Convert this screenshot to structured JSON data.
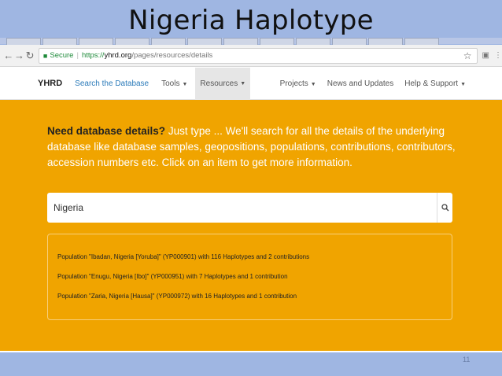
{
  "slide": {
    "title": "Nigeria Haplotype",
    "page_number": "11"
  },
  "browser": {
    "secure_label": "Secure",
    "url_proto": "https://",
    "url_host": "yhrd.org",
    "url_path": "/pages/resources/details"
  },
  "site_nav": {
    "logo": "YHRD",
    "items": [
      {
        "label": "Search the Database"
      },
      {
        "label": "Tools"
      },
      {
        "label": "Resources"
      }
    ],
    "right_items": [
      {
        "label": "Projects"
      },
      {
        "label": "News and Updates"
      },
      {
        "label": "Help & Support"
      }
    ]
  },
  "main": {
    "intro_bold": "Need database details?",
    "intro_text": " Just type ... We'll search for all the details of the underlying database like database samples, geopositions, populations, contributions, contributors, accession numbers etc. Click on an item to get more information.",
    "search_value": "Nigeria",
    "results": [
      "Population \"Ibadan, Nigeria [Yoruba]\" (YP000901) with 116 Haplotypes and 2 contributions",
      "Population \"Enugu, Nigeria [Ibo]\" (YP000951) with 7 Haplotypes and 1 contribution",
      "Population \"Zaria, Nigeria [Hausa]\" (YP000972) with 16 Haplotypes and 1 contribution"
    ]
  },
  "colors": {
    "accent": "#f0a400",
    "link": "#2a7ab9",
    "slide_bg": "#9fb6e2"
  },
  "icons": [
    "back-icon",
    "forward-icon",
    "reload-icon",
    "lock-icon",
    "star-icon",
    "extension-icon",
    "menu-icon",
    "search-icon"
  ]
}
